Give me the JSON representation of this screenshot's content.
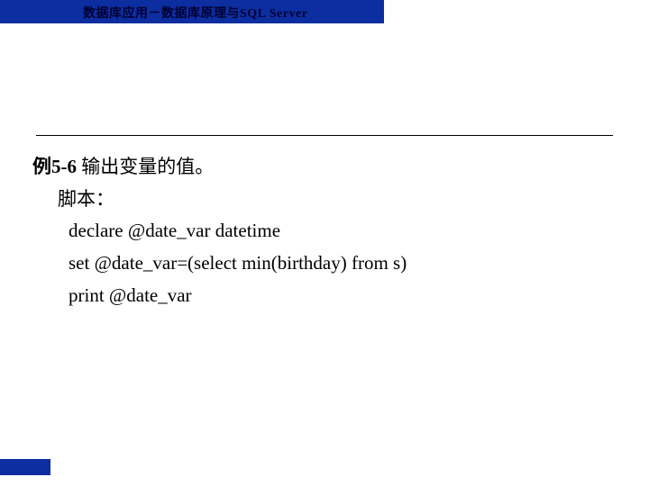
{
  "header": {
    "title_cn": "数据库应用－数据库原理与",
    "title_latin": "SQL Server"
  },
  "example": {
    "label": "例5-6",
    "desc": " 输出变量的值。",
    "script_label": "脚本：",
    "code": {
      "line1": "declare @date_var datetime",
      "line2": "set @date_var=(select min(birthday) from s)",
      "line3": "print @date_var"
    }
  }
}
